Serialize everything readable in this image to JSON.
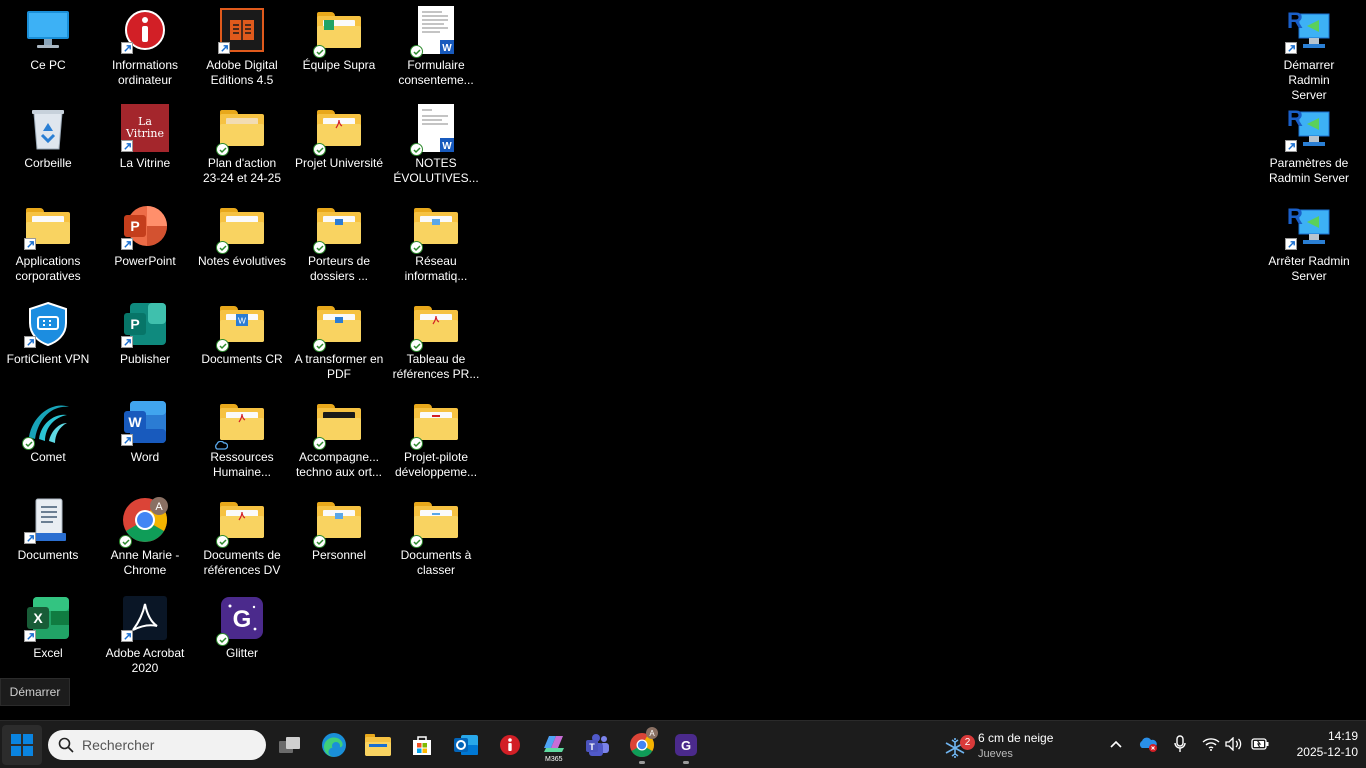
{
  "desktop": {
    "icons": [
      {
        "label": "Ce PC"
      },
      {
        "label": "Corbeille"
      },
      {
        "label": "Applications\ncorporatives"
      },
      {
        "label": "FortiClient VPN"
      },
      {
        "label": "Comet"
      },
      {
        "label": "Documents"
      },
      {
        "label": "Excel"
      },
      {
        "label": "Informations\nordinateur"
      },
      {
        "label": "La Vitrine"
      },
      {
        "label": "PowerPoint"
      },
      {
        "label": "Publisher"
      },
      {
        "label": "Word"
      },
      {
        "label": "Anne Marie -\nChrome"
      },
      {
        "label": "Adobe Acrobat\n2020"
      },
      {
        "label": "Adobe Digital\nEditions 4.5"
      },
      {
        "label": "Plan d'action\n23-24 et 24-25"
      },
      {
        "label": "Notes évolutives"
      },
      {
        "label": "Documents CR"
      },
      {
        "label": "Ressources\nHumaine..."
      },
      {
        "label": "Documents de\nréférences DV"
      },
      {
        "label": "Glitter"
      },
      {
        "label": "Équipe Supra"
      },
      {
        "label": "Projet Université"
      },
      {
        "label": "Porteurs de\ndossiers ..."
      },
      {
        "label": "A transformer en\nPDF"
      },
      {
        "label": "Accompagne...\ntechno aux ort..."
      },
      {
        "label": "Personnel"
      },
      {
        "label": "Formulaire\nconsenteme..."
      },
      {
        "label": "NOTES\nÉVOLUTIVES..."
      },
      {
        "label": "Réseau\ninformatiq..."
      },
      {
        "label": "Tableau de\nréférences PR..."
      },
      {
        "label": "Projet-pilote\ndéveloppeme..."
      },
      {
        "label": "Documents à\nclasser"
      },
      {
        "label": "Démarrer Radmin\nServer"
      },
      {
        "label": "Paramètres de\nRadmin Server"
      },
      {
        "label": "Arrêter Radmin\nServer"
      }
    ],
    "la_vitrine_logo": "La\nVitrine"
  },
  "start_tooltip": "Démarrer",
  "taskbar": {
    "search_placeholder": "Rechercher",
    "weather_badge": "2",
    "weather_line1": "6 cm de neige",
    "weather_line2": "Jueves",
    "time": "14:19",
    "date": "2025-12-10",
    "chrome_avatar": "A",
    "m365_label": "M365"
  },
  "colors": {
    "desktop_bg": "#000000",
    "taskbar_bg": "#1c1c1c",
    "folder_yellow": "#f6c242",
    "sync_green": "#2e8b2e",
    "windows_blue": "#0a84e0"
  }
}
